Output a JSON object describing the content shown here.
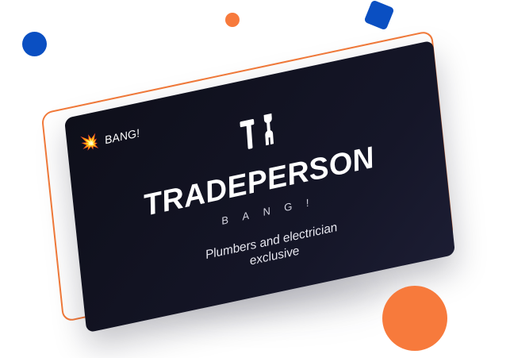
{
  "badge": {
    "icon": "burst-icon",
    "label": "BANG!"
  },
  "logo": {
    "icon": "tools-icon"
  },
  "brand": {
    "title": "TRADEPERSON",
    "subtitle": "BANG!"
  },
  "tagline": {
    "line1": "Plumbers and electrician",
    "line2": "exclusive"
  },
  "colors": {
    "card": "#151628",
    "accent_orange": "#f77a3c",
    "accent_blue": "#0a4fc2",
    "text": "#ffffff"
  }
}
